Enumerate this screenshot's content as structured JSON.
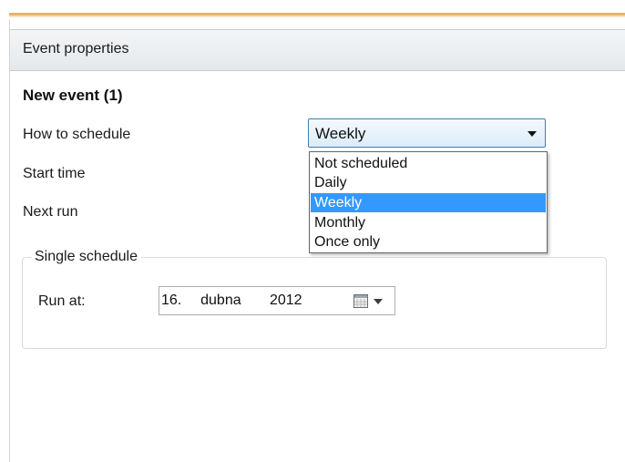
{
  "window": {
    "header_title": "Event properties"
  },
  "event": {
    "name": "New event (1)"
  },
  "form": {
    "how_to_schedule_label": "How to schedule",
    "start_time_label": "Start time",
    "next_run_label": "Next run"
  },
  "schedule_combo": {
    "value": "Weekly",
    "options": [
      "Not scheduled",
      "Daily",
      "Weekly",
      "Monthly",
      "Once only"
    ],
    "selected_index": 2,
    "highlight_color": "#3399ff"
  },
  "single_schedule": {
    "title": "Single schedule",
    "run_at_label": "Run at:",
    "run_at_value": "16.  dubna   2012",
    "picker_icon": "calendar-icon"
  },
  "colors": {
    "accent_stripe": "#e7b46a",
    "combo_border": "#3c7fb1"
  }
}
